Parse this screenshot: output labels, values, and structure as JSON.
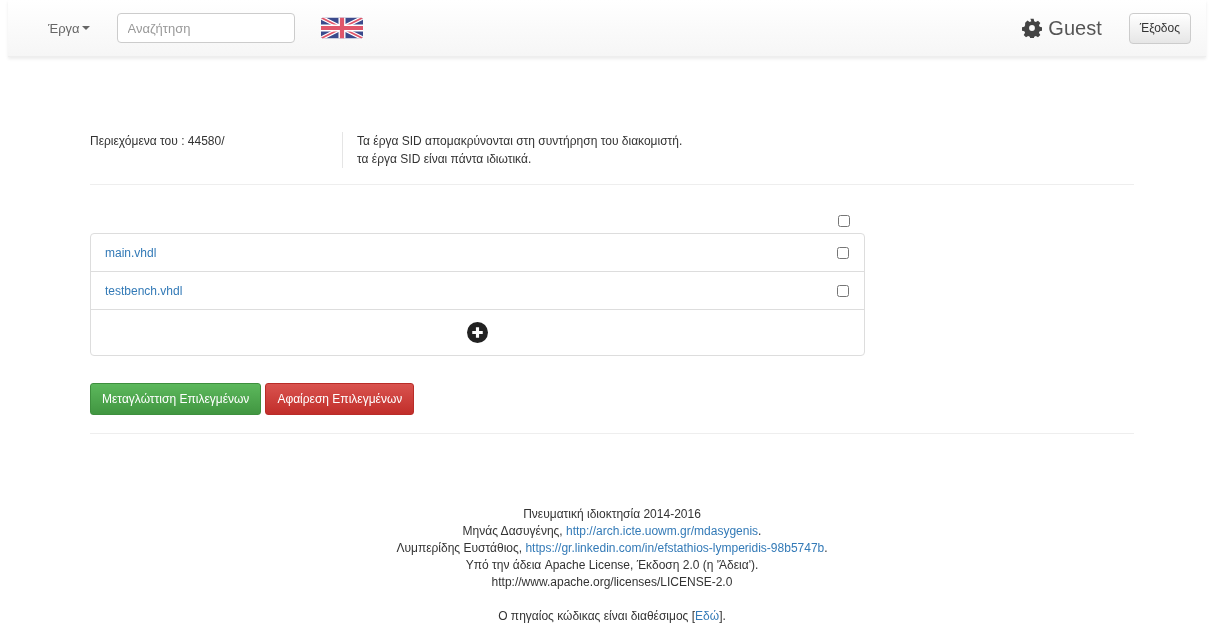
{
  "navbar": {
    "menu_label": "Έργα",
    "search": {
      "placeholder": "Αναζήτηση"
    },
    "user": "Guest",
    "logout": "Έξοδος"
  },
  "info": {
    "path": "Περιεχόμενα του : 44580/",
    "notes": [
      "Τα έργα SID απομακρύνονται στη συντήρηση του διακομιστή.",
      "τα έργα SID είναι πάντα ιδιωτικά."
    ]
  },
  "select_all": {
    "checked": false
  },
  "files": [
    {
      "name": "main.vhdl",
      "checked": false
    },
    {
      "name": "testbench.vhdl",
      "checked": false
    }
  ],
  "buttons": [
    {
      "kind": "success",
      "label": "Μεταγλώττιση Επιλεγμένων"
    },
    {
      "kind": "danger",
      "label": "Αφαίρεση Επιλεγμένων"
    }
  ],
  "footer": [
    {
      "text": "Πνευματική ιδιοκτησία 2014-2016"
    },
    {
      "text": "Μηνάς Δασυγένης, ",
      "link": "http://arch.icte.uowm.gr/mdasygenis",
      "after": "."
    },
    {
      "text": "Λυμπερίδης Ευστάθιος, ",
      "link": "https://gr.linkedin.com/in/efstathios-lymperidis-98b5747b",
      "after": "."
    },
    {
      "text": "Υπό την άδεια Apache License, Έκδοση 2.0 (η 'Άδεια')."
    },
    {
      "text": "http://www.apache.org/licenses/LICENSE-2.0"
    },
    {
      "kind": "gap"
    },
    {
      "text": "Ο πηγαίος κώδικας είναι διαθέσιμος [",
      "link": "Εδώ",
      "after": "]."
    }
  ]
}
